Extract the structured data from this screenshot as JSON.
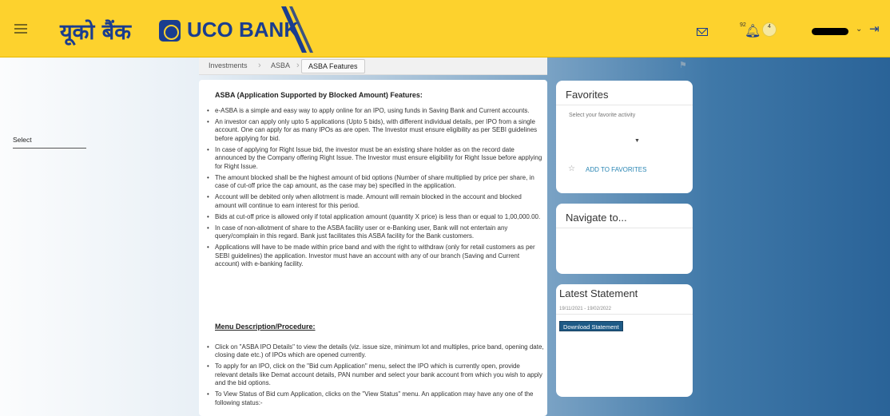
{
  "header": {
    "logo_hindi": "यूको बैंक",
    "logo_english": "UCO BANK",
    "notification_count": "92",
    "avatar_badge": "4",
    "colors": {
      "header_bg": "#fdd22d",
      "brand_blue": "#1a3d8f"
    }
  },
  "breadcrumb": [
    "Investments",
    "ASBA",
    "ASBA Features"
  ],
  "main": {
    "title": "ASBA (Application Supported by Blocked Amount) Features:",
    "bullets": [
      "e-ASBA is a simple and easy way to apply online for an IPO, using funds in Saving Bank and Current accounts.",
      "An investor can apply only upto 5 applications (Upto 5 bids), with different individual details, per IPO from a single account. One can apply for as many IPOs as are open. The Investor must ensure eligibility as per SEBI guidelines before applying for bid.",
      "In case of applying for Right Issue bid, the investor must be an existing share holder as on the record date announced by the Company offering Right Issue. The Investor must ensure eligibility for Right Issue before applying for Right Issue.",
      "The amount blocked shall be the highest amount of bid options (Number of share multiplied by price per share, in case of cut-off price the cap amount, as the case may be) specified in the application.",
      "Account will be debited only when allotment is made. Amount will remain blocked in the account and blocked amount will continue to earn interest for this period.",
      "Bids at cut-off price is allowed only if total application amount (quantity X price) is less than or equal to 1,00,000.00.",
      "In case of non-allotment of share to the ASBA facility user or e-Banking user, Bank will not entertain any query/complain in this regard. Bank just facilitates this ASBA facility for the Bank customers.",
      "Applications will have to be made within price band and with the right to withdraw (only for retail customers as per SEBI guidelines) the application. Investor must have an account with any of our branch (Saving and Current account) with e-banking facility."
    ],
    "menu_heading": "Menu Description/Procedure:",
    "menu_bullets": [
      "Click on \"ASBA IPO Details\" to view the details (viz. issue size, minimum lot and multiples, price band, opening date, closing date etc.) of IPOs which are opened currently.",
      "To apply for an IPO, click on the \"Bid cum Application\" menu, select the IPO which is currently open, provide relevant details like Demat account details, PAN number and select your bank account from which you wish to apply and the bid options.",
      "To View Status of Bid cum Application, clicks on the \"View Status\" menu. An application may have any one of the following status:-"
    ]
  },
  "favorites": {
    "title": "Favorites",
    "subtitle": "Select your favorite activity",
    "select_value": "Select",
    "add_label": "ADD TO FAVORITES"
  },
  "navigate": {
    "title": "Navigate to..."
  },
  "statement": {
    "title": "Latest Statement",
    "dates": "19/11/2021  -  19/02/2022",
    "download_label": "Download Statement"
  }
}
